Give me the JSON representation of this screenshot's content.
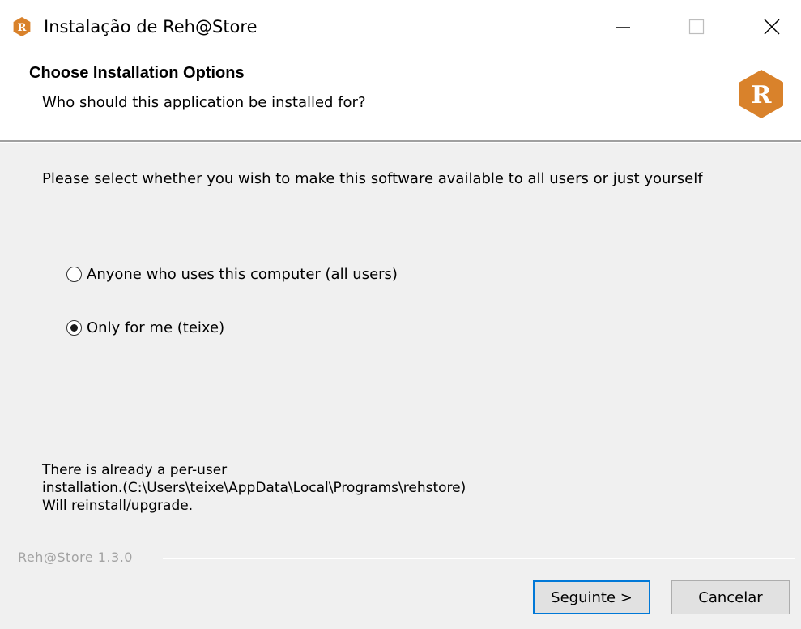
{
  "window": {
    "title": "Instalação de Reh@Store",
    "controls": {
      "minimize": "minimize-icon",
      "maximize": "maximize-icon",
      "close": "close-icon"
    }
  },
  "header": {
    "title": "Choose Installation Options",
    "subtitle": "Who should this application be installed for?",
    "logo_letter": "R",
    "logo_color": "#d9822b"
  },
  "content": {
    "intro": "Please select whether you wish to make this software available to all users or just yourself",
    "options": [
      {
        "label": "Anyone who uses this computer (all users)",
        "selected": false
      },
      {
        "label": "Only for me (teixe)",
        "selected": true
      }
    ],
    "notice_lines": [
      "There is already a per-user",
      "installation.(C:\\Users\\teixe\\AppData\\Local\\Programs\\rehstore)",
      "Will reinstall/upgrade."
    ]
  },
  "footer": {
    "branding": "Reh@Store 1.3.0",
    "next_label": "Seguinte >",
    "cancel_label": "Cancelar"
  },
  "colors": {
    "accent": "#0078d7",
    "brand": "#d9822b",
    "window_bg": "#f0f0f0"
  }
}
